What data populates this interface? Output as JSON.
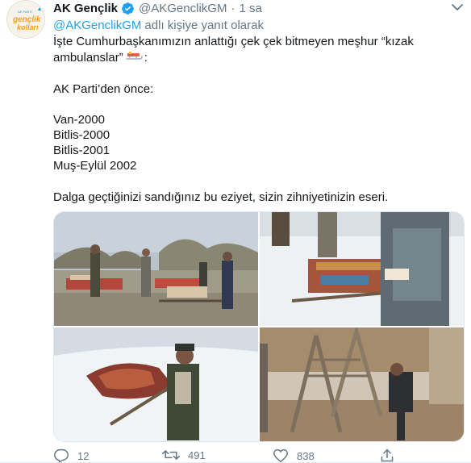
{
  "account": {
    "display_name": "AK Gençlik",
    "handle": "@AKGenclikGM",
    "time": "1 sa",
    "separator": "·",
    "avatar_text_top": "AK PARTİ",
    "avatar_text_mid": "gençlik",
    "avatar_text_bottom": "kolları"
  },
  "reply": {
    "mention": "@AKGenclikGM",
    "label": "adlı kişiye yanıt olarak"
  },
  "body": {
    "line1": "İşte Cumhurbaşkanımızın anlattığı çek çek bitmeyen meşhur “kızak",
    "line2_before": "ambulanslar”",
    "line2_after": ":",
    "line3": "AK Parti’den önce:",
    "line4": "Van-2000",
    "line5": "Bitlis-2000",
    "line6": "Bitlis-2001",
    "line7": "Muş-Eylül 2002",
    "line8": "Dalga geçtiğinizi sandığınız bu eziyet, sizin zihniyetinizin eseri."
  },
  "media": {
    "photos": [
      {
        "name": "photo-van-2000"
      },
      {
        "name": "photo-bitlis-2000"
      },
      {
        "name": "photo-bitlis-2001"
      },
      {
        "name": "photo-mus-2002"
      }
    ]
  },
  "actions": {
    "reply_count": "12",
    "retweet_count": "491",
    "like_count": "838"
  },
  "icons": {
    "verified": "verified-badge-icon",
    "caret": "chevron-down-icon",
    "reply": "reply-icon",
    "retweet": "retweet-icon",
    "like": "heart-icon",
    "share": "share-icon",
    "sled": "sled-emoji-icon"
  },
  "colors": {
    "link": "#1da1f2",
    "muted": "#657786",
    "text": "#14171a",
    "avatar_orange": "#f4a01c",
    "avatar_blue": "#1b9bd7"
  }
}
